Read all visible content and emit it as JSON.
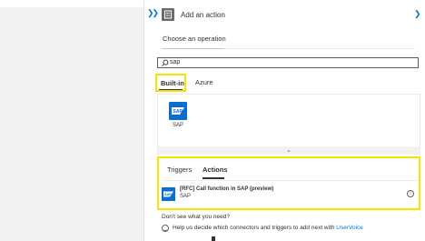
{
  "header": {
    "title": "Add an action",
    "expand_icon": "double-chevron-right-icon",
    "close_icon": "chevron-down-icon"
  },
  "subtitle": "Choose an operation",
  "search": {
    "value": "sap",
    "icon": "search-icon"
  },
  "tabs": [
    {
      "label": "Built-in",
      "selected": true
    },
    {
      "label": "Azure",
      "selected": false
    }
  ],
  "connectors": [
    {
      "label": "SAP",
      "icon": "sap-logo-icon"
    }
  ],
  "result_tabs": [
    {
      "label": "Triggers",
      "selected": false
    },
    {
      "label": "Actions",
      "selected": true
    }
  ],
  "results": [
    {
      "title": "[RFC] Call function in SAP (preview)",
      "subtitle": "SAP",
      "icon": "sap-logo-icon"
    }
  ],
  "footer": {
    "question": "Don't see what you need?",
    "help_text": "Help us decide which connectors and triggers to add next with ",
    "link_text": "UserVoice"
  },
  "colors": {
    "accent": "#0078d4",
    "highlight": "#f5e400",
    "sap_blue": "#0a6ed1",
    "pane_bg": "#f3f2f1"
  }
}
